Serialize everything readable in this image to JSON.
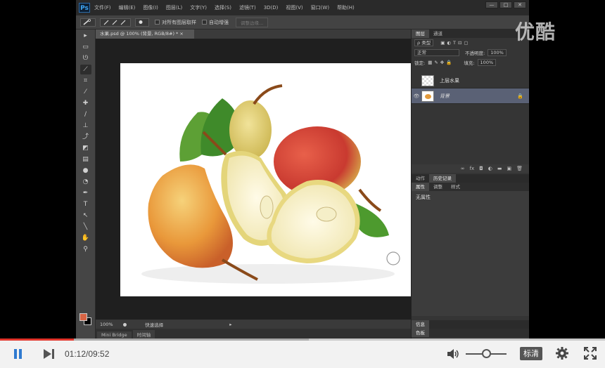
{
  "ps": {
    "logo": "Ps",
    "menus": [
      "文件(F)",
      "编辑(E)",
      "图像(I)",
      "图层(L)",
      "文字(Y)",
      "选择(S)",
      "滤镜(T)",
      "3D(D)",
      "视图(V)",
      "窗口(W)",
      "帮助(H)"
    ],
    "window_buttons": [
      "—",
      "□",
      "✕"
    ],
    "options": {
      "sample_all_layers": "对所有图层取样",
      "auto_enhance": "自动增强",
      "refine_edge": "调整边缘..."
    },
    "doc_tab": "水果.psd @ 100% (背景, RGB/8#) * ×",
    "status": {
      "zoom": "100%",
      "field": "快速选择"
    },
    "bottom_tabs": [
      "Mini Bridge",
      "时间轴"
    ],
    "layers_panel": {
      "tabs": [
        "图层",
        "通道"
      ],
      "filter_kind": "ρ 类型",
      "blend_mode": "正常",
      "opacity_label": "不透明度:",
      "opacity_value": "100%",
      "lock_label": "锁定:",
      "fill_label": "填充:",
      "fill_value": "100%",
      "layers": [
        {
          "name": "上层水果",
          "visible": false,
          "selected": false,
          "thumb": "checker"
        },
        {
          "name": "背景",
          "visible": true,
          "selected": true,
          "thumb": "pear"
        }
      ]
    },
    "props_panel": {
      "tabs1": [
        "动作",
        "历史记录"
      ],
      "tabs2": [
        "属性",
        "调整",
        "样式"
      ],
      "body": "无属性"
    },
    "info_panel": {
      "tabs1": [
        "信息"
      ],
      "tabs2": [
        "色板"
      ]
    }
  },
  "watermark": "优酷",
  "player": {
    "time": "01:12/09:52",
    "progress": 0.122,
    "buffered": 0.51,
    "volume": 0.5,
    "quality": "标清"
  },
  "colors": {
    "accent": "#e2342b",
    "foreground_swatch": "#d96444"
  }
}
